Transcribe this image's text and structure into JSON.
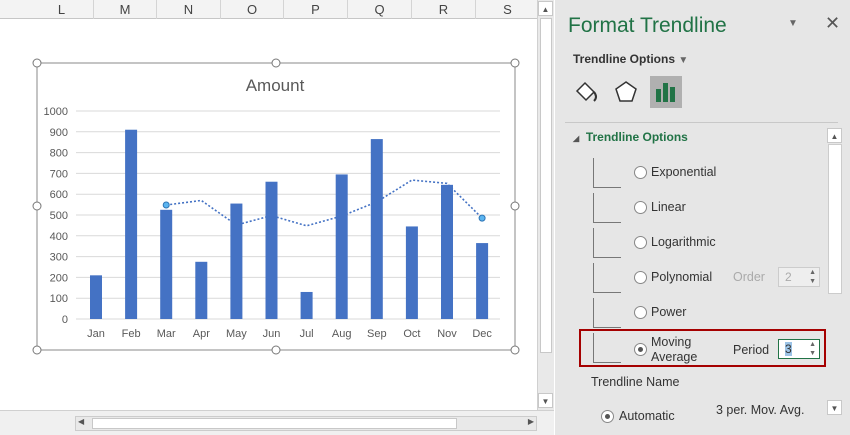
{
  "columns": [
    "L",
    "M",
    "N",
    "O",
    "P",
    "Q",
    "R",
    "S"
  ],
  "chart_data": {
    "type": "bar",
    "title": "Amount",
    "categories": [
      "Jan",
      "Feb",
      "Mar",
      "Apr",
      "May",
      "Jun",
      "Jul",
      "Aug",
      "Sep",
      "Oct",
      "Nov",
      "Dec"
    ],
    "values": [
      210,
      910,
      525,
      275,
      555,
      660,
      130,
      695,
      865,
      445,
      645,
      365
    ],
    "trendline": {
      "type": "moving average",
      "period": 3,
      "values": [
        null,
        null,
        548,
        570,
        452,
        497,
        448,
        495,
        563,
        668,
        652,
        485
      ]
    },
    "ylim": [
      0,
      1000
    ],
    "yticks": [
      "0",
      "100",
      "200",
      "300",
      "400",
      "500",
      "600",
      "700",
      "800",
      "900",
      "1000"
    ],
    "grid": true,
    "colors": {
      "bar": "#4472c4",
      "trend": "#4472c4"
    }
  },
  "panel": {
    "title": "Format Trendline",
    "options_dropdown": "Trendline Options",
    "section": "Trendline Options",
    "types": [
      {
        "label": "Exponential",
        "selected": false
      },
      {
        "label": "Linear",
        "selected": false
      },
      {
        "label": "Logarithmic",
        "selected": false
      },
      {
        "label": "Polynomial",
        "selected": false
      },
      {
        "label": "Power",
        "selected": false
      },
      {
        "label": "Moving Average",
        "selected": true
      }
    ],
    "order_label": "Order",
    "order_value": "2",
    "period_label": "Period",
    "period_value": "3",
    "name_label": "Trendline Name",
    "automatic_label": "Automatic",
    "automatic_value": "3 per. Mov. Avg.",
    "accent": "#217346",
    "highlight": "#a50000"
  }
}
